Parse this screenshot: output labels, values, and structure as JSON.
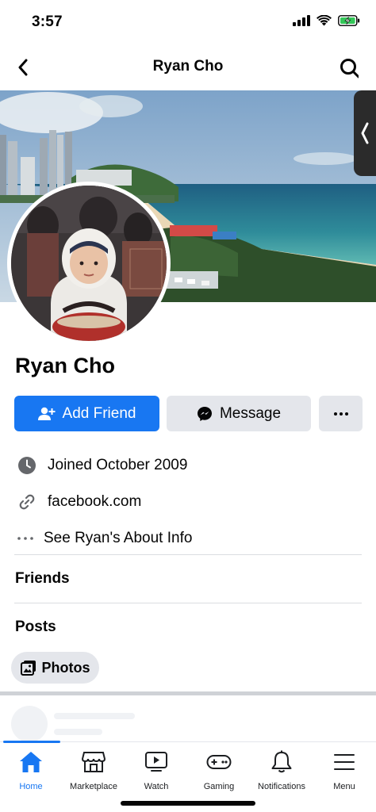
{
  "status_bar": {
    "time": "3:57"
  },
  "nav": {
    "title": "Ryan Cho"
  },
  "profile": {
    "name": "Ryan Cho"
  },
  "actions": {
    "add_friend": "Add Friend",
    "message": "Message"
  },
  "intro": {
    "joined": "Joined October 2009",
    "website": "facebook.com",
    "about": "See Ryan's About Info"
  },
  "sections": {
    "friends": "Friends",
    "posts": "Posts"
  },
  "filters": {
    "photos": "Photos"
  },
  "tab_bar": {
    "items": [
      {
        "label": "Home",
        "icon": "home-icon",
        "active": true
      },
      {
        "label": "Marketplace",
        "icon": "marketplace-icon",
        "active": false
      },
      {
        "label": "Watch",
        "icon": "watch-icon",
        "active": false
      },
      {
        "label": "Gaming",
        "icon": "gaming-icon",
        "active": false
      },
      {
        "label": "Notifications",
        "icon": "bell-icon",
        "active": false
      },
      {
        "label": "Menu",
        "icon": "menu-icon",
        "active": false
      }
    ]
  },
  "colors": {
    "accent": "#1877f2",
    "button_gray": "#e4e6eb",
    "battery_green": "#34c759"
  }
}
